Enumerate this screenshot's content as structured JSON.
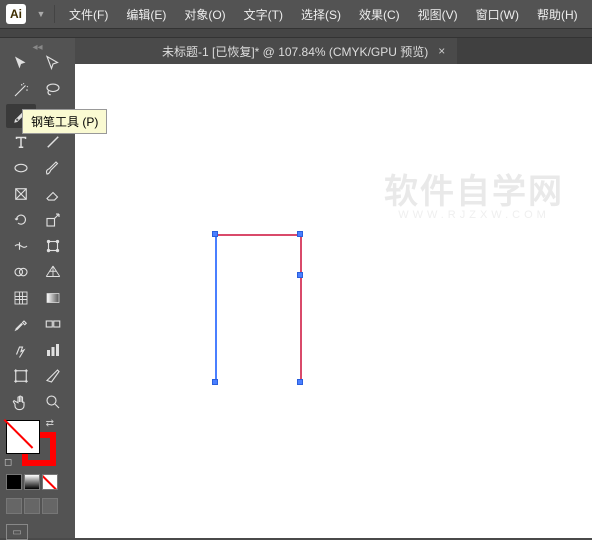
{
  "menubar": {
    "app": "Ai",
    "items": [
      "文件(F)",
      "编辑(E)",
      "对象(O)",
      "文字(T)",
      "选择(S)",
      "效果(C)",
      "视图(V)",
      "窗口(W)",
      "帮助(H)"
    ]
  },
  "tab": {
    "title": "未标题-1 [已恢复]* @ 107.84% (CMYK/GPU 预览)",
    "close": "×"
  },
  "tooltip": "钢笔工具 (P)",
  "watermark": {
    "main": "软件自学网",
    "sub": "WWW.RJZXW.COM"
  },
  "tools": {
    "selection": "selection-tool",
    "direct": "direct-selection-tool",
    "wand": "magic-wand-tool",
    "lasso": "lasso-tool",
    "pen": "pen-tool",
    "curvature": "curvature-tool",
    "type": "type-tool",
    "line": "line-segment-tool",
    "rect": "rectangle-tool",
    "brush": "paintbrush-tool",
    "shaper": "shaper-tool",
    "eraser": "eraser-tool",
    "rotate": "rotate-tool",
    "scale": "scale-tool",
    "width": "width-tool",
    "free": "free-transform-tool",
    "shapebuilder": "shape-builder-tool",
    "perspgrid": "perspective-grid-tool",
    "mesh": "mesh-tool",
    "gradient": "gradient-tool",
    "eyedrop": "eyedropper-tool",
    "measure": "measure-tool",
    "blend": "blend-tool",
    "graph": "column-graph-tool",
    "symbol": "symbol-sprayer-tool",
    "artboard": "artboard-tool",
    "slice": "slice-tool",
    "hand": "hand-tool",
    "zoom": "zoom-tool"
  },
  "colors": {
    "stroke": "#ff0000",
    "path": "#d94a6a",
    "selection": "#4a7fff"
  }
}
